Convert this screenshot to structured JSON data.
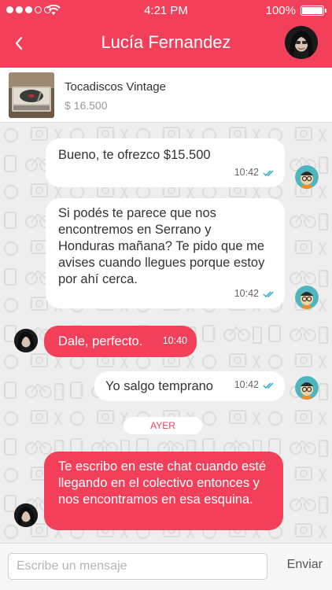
{
  "status_bar": {
    "time": "4:21 PM",
    "battery": "100%"
  },
  "header": {
    "title": "Lucía Fernandez",
    "back_icon": "chevron-left-icon"
  },
  "product": {
    "name": "Tocadiscos Vintage",
    "price": "$ 16.500"
  },
  "messages": [
    {
      "from": "me",
      "text": "Bueno, te ofrezco $15.500",
      "time": "10:42",
      "read": true
    },
    {
      "from": "me",
      "text": "Si podés te parece que nos encontremos en Serrano y Honduras mañana? Te pido que me avises cuando llegues porque estoy por ahí cerca.",
      "time": "10:42",
      "read": true
    },
    {
      "from": "her",
      "text": "Dale, perfecto.",
      "time": "10:40"
    },
    {
      "from": "me",
      "text": "Yo salgo temprano",
      "time": "10:42",
      "read": true
    },
    {
      "from": "her",
      "text": "Te escribo en este chat cuando esté llegando en el colectivo entonces y nos encontramos en esa esquina."
    }
  ],
  "day_separator": "AYER",
  "composer": {
    "placeholder": "Escribe un mensaje",
    "send_label": "Enviar"
  },
  "colors": {
    "accent": "#f2405a",
    "read_tick": "#2fa9d6"
  }
}
